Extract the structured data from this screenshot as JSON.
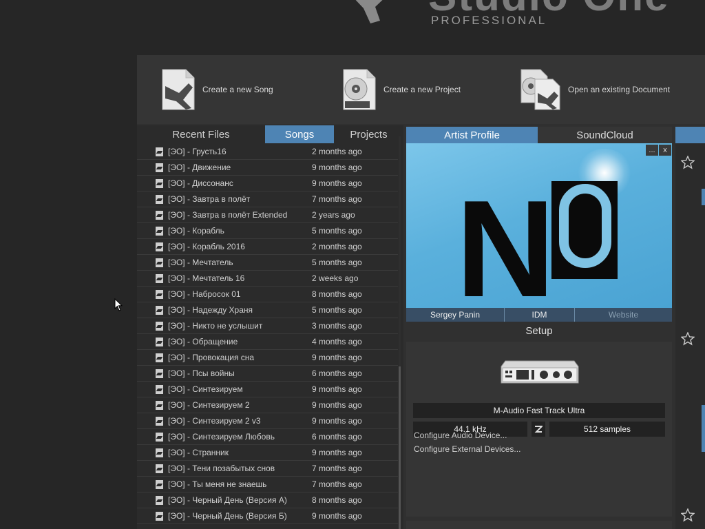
{
  "logo": {
    "word": "Studio One",
    "sub": "PROFESSIONAL"
  },
  "actions": [
    {
      "label": "Create a new Song"
    },
    {
      "label": "Create a new Project"
    },
    {
      "label": "Open an existing Document"
    }
  ],
  "recent": {
    "tabs": [
      {
        "label": "Recent Files",
        "active": false
      },
      {
        "label": "Songs",
        "active": true
      },
      {
        "label": "Projects",
        "active": false
      }
    ],
    "files": [
      {
        "name": "[ЭО] - Грусть16",
        "date": "2 months ago"
      },
      {
        "name": "[ЭО] - Движение",
        "date": "9 months ago"
      },
      {
        "name": "[ЭО] - Диссонанс",
        "date": "9 months ago"
      },
      {
        "name": "[ЭО] - Завтра в полёт",
        "date": "7 months ago"
      },
      {
        "name": "[ЭО] - Завтра в полёт Extended",
        "date": "2 years ago"
      },
      {
        "name": "[ЭО] - Корабль",
        "date": "5 months ago"
      },
      {
        "name": "[ЭО] - Корабль 2016",
        "date": "2 months ago"
      },
      {
        "name": "[ЭО] - Мечтатель",
        "date": "5 months ago"
      },
      {
        "name": "[ЭО] - Мечтатель 16",
        "date": "2 weeks ago"
      },
      {
        "name": "[ЭО] - Набросок 01",
        "date": "8 months ago"
      },
      {
        "name": "[ЭО] - Надежду Храня",
        "date": "5 months ago"
      },
      {
        "name": "[ЭО] - Никто не услышит",
        "date": "3 months ago"
      },
      {
        "name": "[ЭО] - Обращение",
        "date": "4 months ago"
      },
      {
        "name": "[ЭО] - Провокация сна",
        "date": "9 months ago"
      },
      {
        "name": "[ЭО] - Псы войны",
        "date": "6 months ago"
      },
      {
        "name": "[ЭО] - Синтезируем",
        "date": "9 months ago"
      },
      {
        "name": "[ЭО] - Синтезируем 2",
        "date": "9 months ago"
      },
      {
        "name": "[ЭО] - Синтезируем 2 v3",
        "date": "9 months ago"
      },
      {
        "name": "[ЭО] - Синтезируем Любовь",
        "date": "6 months ago"
      },
      {
        "name": "[ЭО] - Странник",
        "date": "9 months ago"
      },
      {
        "name": "[ЭО] - Тени позабытых снов",
        "date": "7 months ago"
      },
      {
        "name": "[ЭО] - Ты меня не знаешь",
        "date": "7 months ago"
      },
      {
        "name": "[ЭО] - Черный День (Версия А)",
        "date": "8 months ago"
      },
      {
        "name": "[ЭО] - Черный День (Версия Б)",
        "date": "9 months ago"
      }
    ]
  },
  "artist": {
    "tabs": [
      {
        "label": "Artist Profile",
        "active": true
      },
      {
        "label": "SoundCloud",
        "active": false
      }
    ],
    "image_text": "NO",
    "more_button": "...",
    "close_button": "x",
    "footer": [
      {
        "label": "Sergey Panin"
      },
      {
        "label": "IDM"
      },
      {
        "label": "Website"
      }
    ]
  },
  "setup": {
    "title": "Setup",
    "device": "M-Audio Fast Track Ultra",
    "sample_rate": "44.1 kHz",
    "buffer": "512 samples",
    "configure_audio": "Configure Audio Device...",
    "configure_external": "Configure External Devices..."
  },
  "colors": {
    "accent": "#4e84b4",
    "background": "#262626",
    "panel": "#303030"
  }
}
